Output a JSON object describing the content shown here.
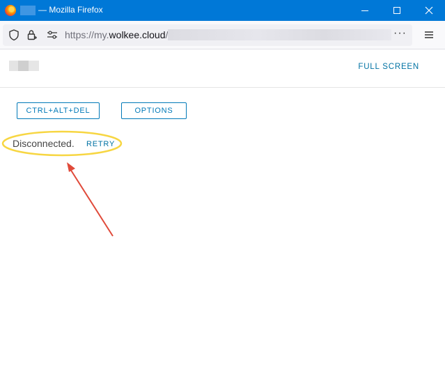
{
  "window": {
    "title": "— Mozilla Firefox",
    "controls": {
      "minimize": "minimize",
      "maximize": "maximize",
      "close": "close"
    }
  },
  "browser": {
    "url_prefix": "https://my.",
    "url_host": "wolkee.cloud",
    "url_slash": "/",
    "overflow_menu": "···"
  },
  "app": {
    "fullscreen_label": "FULL SCREEN",
    "ctrl_alt_del_label": "CTRL+ALT+DEL",
    "options_label": "OPTIONS",
    "status_text": "Disconnected.",
    "retry_label": "RETRY"
  },
  "colors": {
    "titlebar": "#0078d7",
    "accent": "#0079b8",
    "highlight_ellipse": "#f7d642",
    "annotation_arrow": "#e04a3a"
  }
}
